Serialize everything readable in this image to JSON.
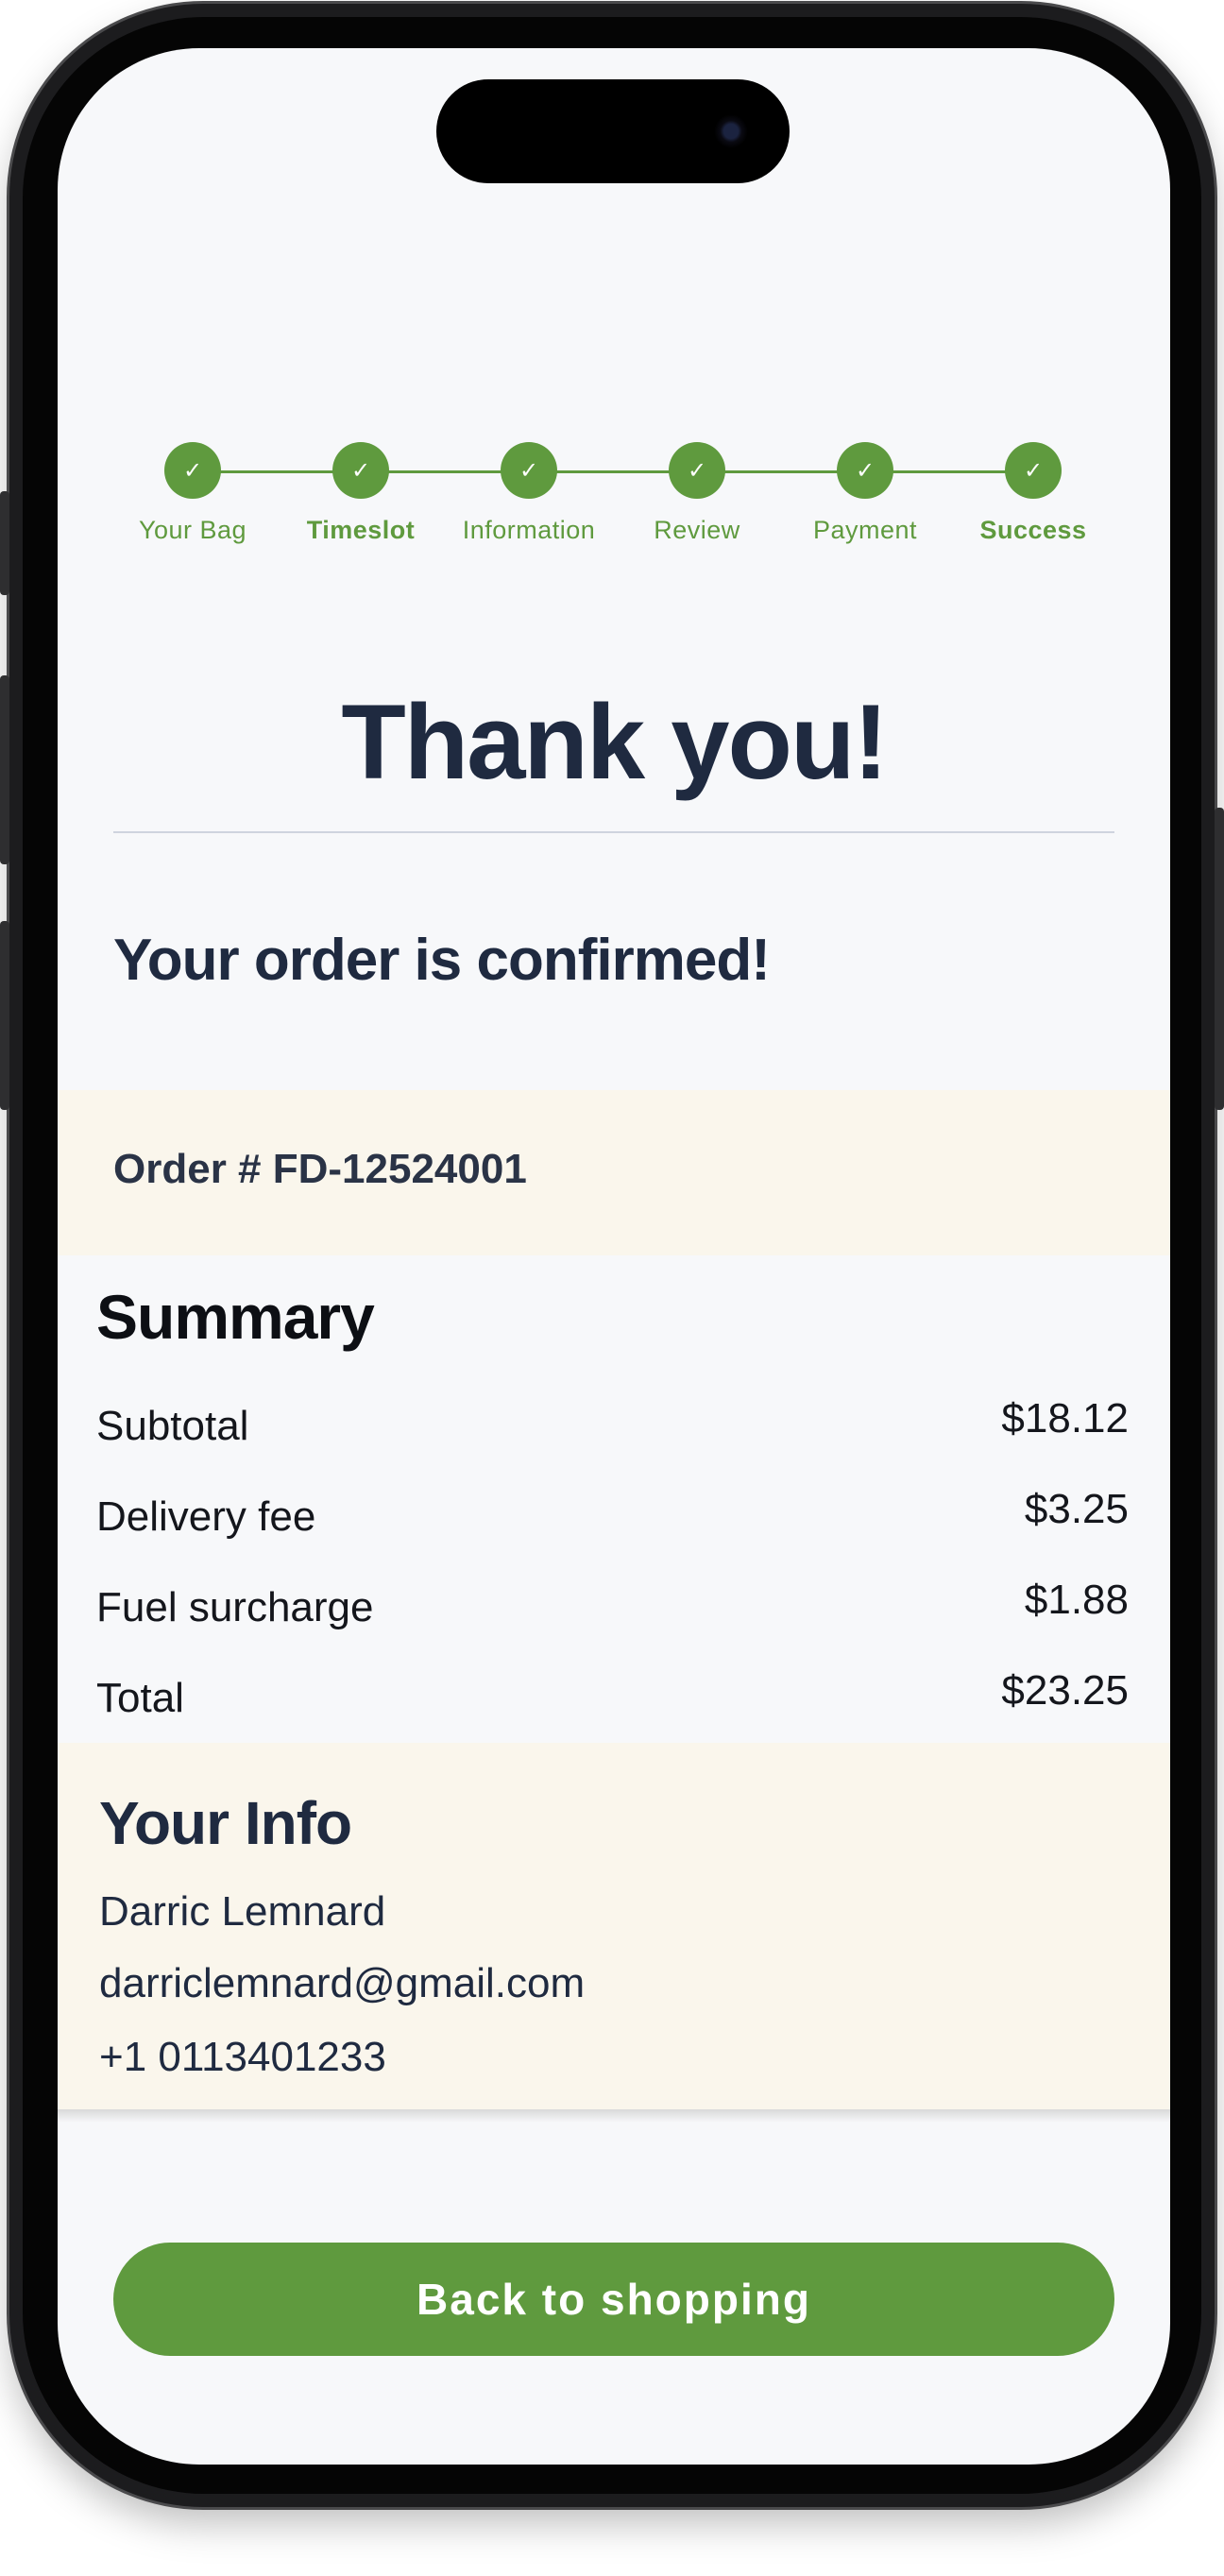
{
  "colors": {
    "accent": "#5f9a3e",
    "heading": "#1f2a40",
    "band": "#faf6ec",
    "screen_bg": "#f7f8fa"
  },
  "stepper": {
    "steps": [
      {
        "label": "Your Bag",
        "icon": "check-icon",
        "bold": false
      },
      {
        "label": "Timeslot",
        "icon": "check-icon",
        "bold": true
      },
      {
        "label": "Information",
        "icon": "check-icon",
        "bold": false
      },
      {
        "label": "Review",
        "icon": "check-icon",
        "bold": false
      },
      {
        "label": "Payment",
        "icon": "check-icon",
        "bold": false
      },
      {
        "label": "Success",
        "icon": "check-icon",
        "bold": true
      }
    ]
  },
  "main": {
    "title": "Thank you!",
    "confirmation": "Your order is confirmed!",
    "order_number": "Order # FD-12524001"
  },
  "summary": {
    "title": "Summary",
    "rows": [
      {
        "label": "Subtotal",
        "value": "$18.12"
      },
      {
        "label": "Delivery fee",
        "value": "$3.25"
      },
      {
        "label": "Fuel surcharge",
        "value": "$1.88"
      },
      {
        "label": "Total",
        "value": "$23.25"
      }
    ]
  },
  "info": {
    "title": "Your Info",
    "name": "Darric Lemnard",
    "email": "darriclemnard@gmail.com",
    "phone": "+1 0113401233"
  },
  "cta": {
    "label": "Back to shopping"
  }
}
